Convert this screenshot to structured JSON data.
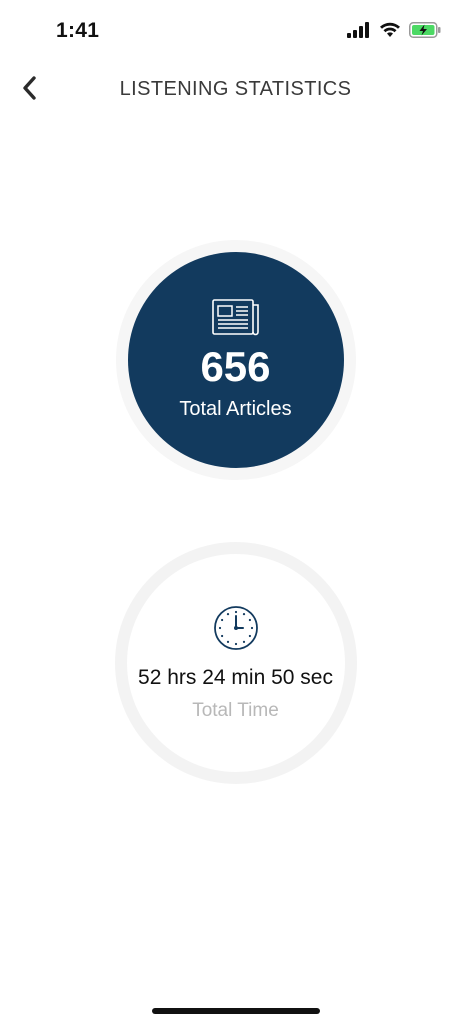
{
  "status_bar": {
    "time": "1:41",
    "icons": [
      "signal-icon",
      "wifi-icon",
      "battery-charging-icon"
    ],
    "battery_color": "#4cd964"
  },
  "header": {
    "title": "LISTENING STATISTICS",
    "back_icon": "chevron-left-icon"
  },
  "articles": {
    "count": "656",
    "label": "Total Articles",
    "icon": "newspaper-icon",
    "color": "#123a5e"
  },
  "time": {
    "value": "52 hrs 24 min 50 sec",
    "label": "Total Time",
    "icon": "clock-icon"
  }
}
